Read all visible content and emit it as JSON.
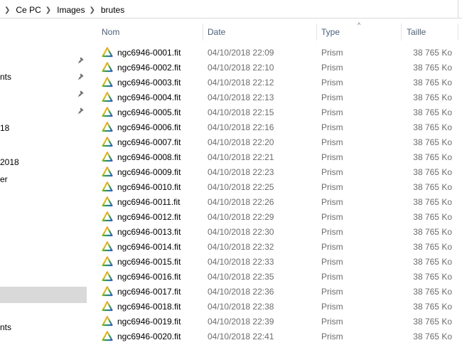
{
  "breadcrumb": [
    "Ce PC",
    "Images",
    "brutes"
  ],
  "nav": {
    "items": [
      {
        "label": "nts",
        "pinned": true
      },
      {
        "label": "",
        "pinned": true
      },
      {
        "label": "",
        "pinned": true
      },
      {
        "label": "",
        "pinned": true
      },
      {
        "label": "18",
        "pinned": false
      },
      {
        "label": "2018",
        "pinned": false
      },
      {
        "label": "er",
        "pinned": false
      },
      {
        "label": "nts",
        "pinned": false
      }
    ]
  },
  "columns": {
    "name": "Nom",
    "date": "Date",
    "type": "Type",
    "size": "Taille",
    "sort_indicator": "^"
  },
  "files": [
    {
      "name": "ngc6946-0001.fit",
      "date": "04/10/2018 22:09",
      "type": "Prism",
      "size": "38 765 Ko"
    },
    {
      "name": "ngc6946-0002.fit",
      "date": "04/10/2018 22:10",
      "type": "Prism",
      "size": "38 765 Ko"
    },
    {
      "name": "ngc6946-0003.fit",
      "date": "04/10/2018 22:12",
      "type": "Prism",
      "size": "38 765 Ko"
    },
    {
      "name": "ngc6946-0004.fit",
      "date": "04/10/2018 22:13",
      "type": "Prism",
      "size": "38 765 Ko"
    },
    {
      "name": "ngc6946-0005.fit",
      "date": "04/10/2018 22:15",
      "type": "Prism",
      "size": "38 765 Ko"
    },
    {
      "name": "ngc6946-0006.fit",
      "date": "04/10/2018 22:16",
      "type": "Prism",
      "size": "38 765 Ko"
    },
    {
      "name": "ngc6946-0007.fit",
      "date": "04/10/2018 22:20",
      "type": "Prism",
      "size": "38 765 Ko"
    },
    {
      "name": "ngc6946-0008.fit",
      "date": "04/10/2018 22:21",
      "type": "Prism",
      "size": "38 765 Ko"
    },
    {
      "name": "ngc6946-0009.fit",
      "date": "04/10/2018 22:23",
      "type": "Prism",
      "size": "38 765 Ko"
    },
    {
      "name": "ngc6946-0010.fit",
      "date": "04/10/2018 22:25",
      "type": "Prism",
      "size": "38 765 Ko"
    },
    {
      "name": "ngc6946-0011.fit",
      "date": "04/10/2018 22:26",
      "type": "Prism",
      "size": "38 765 Ko"
    },
    {
      "name": "ngc6946-0012.fit",
      "date": "04/10/2018 22:29",
      "type": "Prism",
      "size": "38 765 Ko"
    },
    {
      "name": "ngc6946-0013.fit",
      "date": "04/10/2018 22:30",
      "type": "Prism",
      "size": "38 765 Ko"
    },
    {
      "name": "ngc6946-0014.fit",
      "date": "04/10/2018 22:32",
      "type": "Prism",
      "size": "38 765 Ko"
    },
    {
      "name": "ngc6946-0015.fit",
      "date": "04/10/2018 22:33",
      "type": "Prism",
      "size": "38 765 Ko"
    },
    {
      "name": "ngc6946-0016.fit",
      "date": "04/10/2018 22:35",
      "type": "Prism",
      "size": "38 765 Ko"
    },
    {
      "name": "ngc6946-0017.fit",
      "date": "04/10/2018 22:36",
      "type": "Prism",
      "size": "38 765 Ko"
    },
    {
      "name": "ngc6946-0018.fit",
      "date": "04/10/2018 22:38",
      "type": "Prism",
      "size": "38 765 Ko"
    },
    {
      "name": "ngc6946-0019.fit",
      "date": "04/10/2018 22:39",
      "type": "Prism",
      "size": "38 765 Ko"
    },
    {
      "name": "ngc6946-0020.fit",
      "date": "04/10/2018 22:41",
      "type": "Prism",
      "size": "38 765 Ko"
    }
  ],
  "icons": {
    "file": "prism-file-icon",
    "pin": "pin-icon",
    "separator": "chevron-right-icon"
  },
  "colors": {
    "header_text": "#4c607a",
    "meta_text": "#6d6d6d",
    "selected_nav": "#d9d9d9"
  }
}
